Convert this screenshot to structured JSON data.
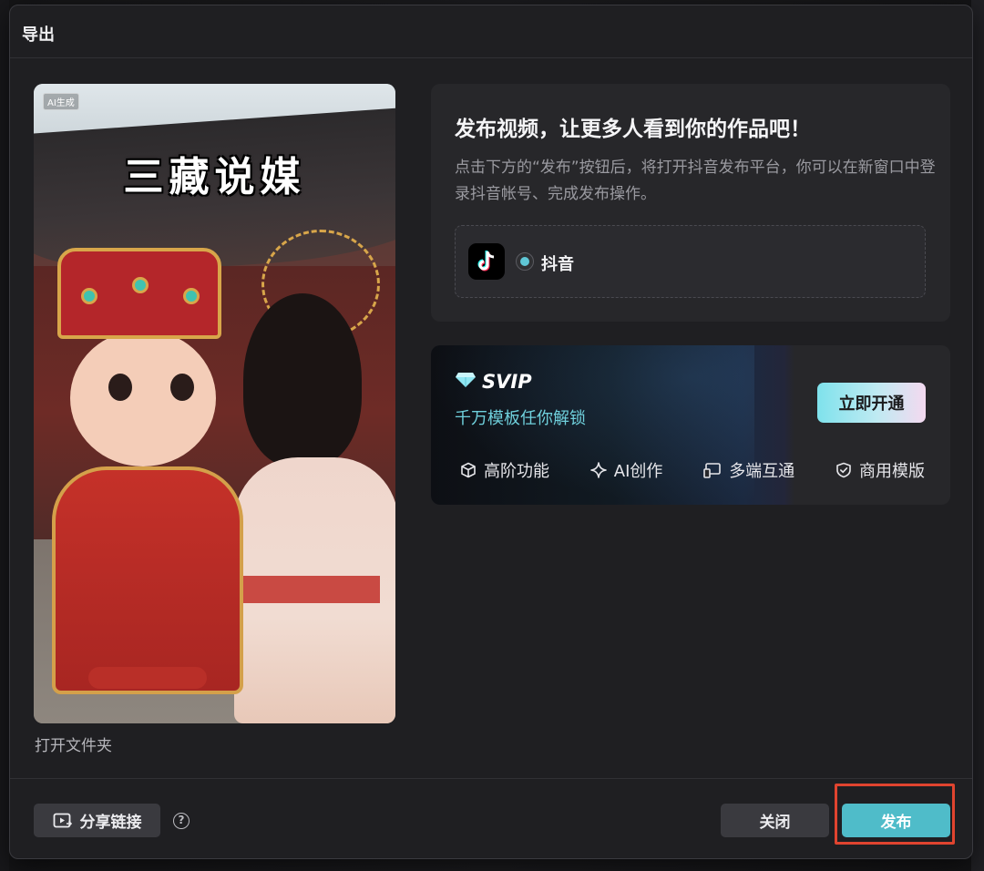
{
  "dialog": {
    "title": "导出"
  },
  "preview": {
    "badge": "AI生成",
    "overlay_title": "三藏说媒",
    "open_folder_label": "打开文件夹"
  },
  "publish": {
    "heading": "发布视频，让更多人看到你的作品吧！",
    "description": "点击下方的“发布”按钮后，将打开抖音发布平台，你可以在新窗口中登录抖音帐号、完成发布操作。",
    "platform": {
      "label": "抖音",
      "selected": true,
      "icon": "douyin-logo-icon"
    }
  },
  "svip": {
    "title": "SVIP",
    "subtitle": "千万模板任你解锁",
    "button_label": "立即开通",
    "features": [
      {
        "label": "高阶功能",
        "icon": "cube-icon"
      },
      {
        "label": "AI创作",
        "icon": "sparkle-icon"
      },
      {
        "label": "多端互通",
        "icon": "devices-icon"
      },
      {
        "label": "商用模版",
        "icon": "shield-check-icon"
      }
    ]
  },
  "footer": {
    "share_label": "分享链接",
    "help_symbol": "?",
    "close_label": "关闭",
    "publish_label": "发布"
  },
  "colors": {
    "accent": "#4fbcc9",
    "svip_subtitle": "#6fd0dc",
    "highlight": "#e0442f",
    "dialog_bg": "#1f1f22",
    "card_bg": "#27272a"
  }
}
